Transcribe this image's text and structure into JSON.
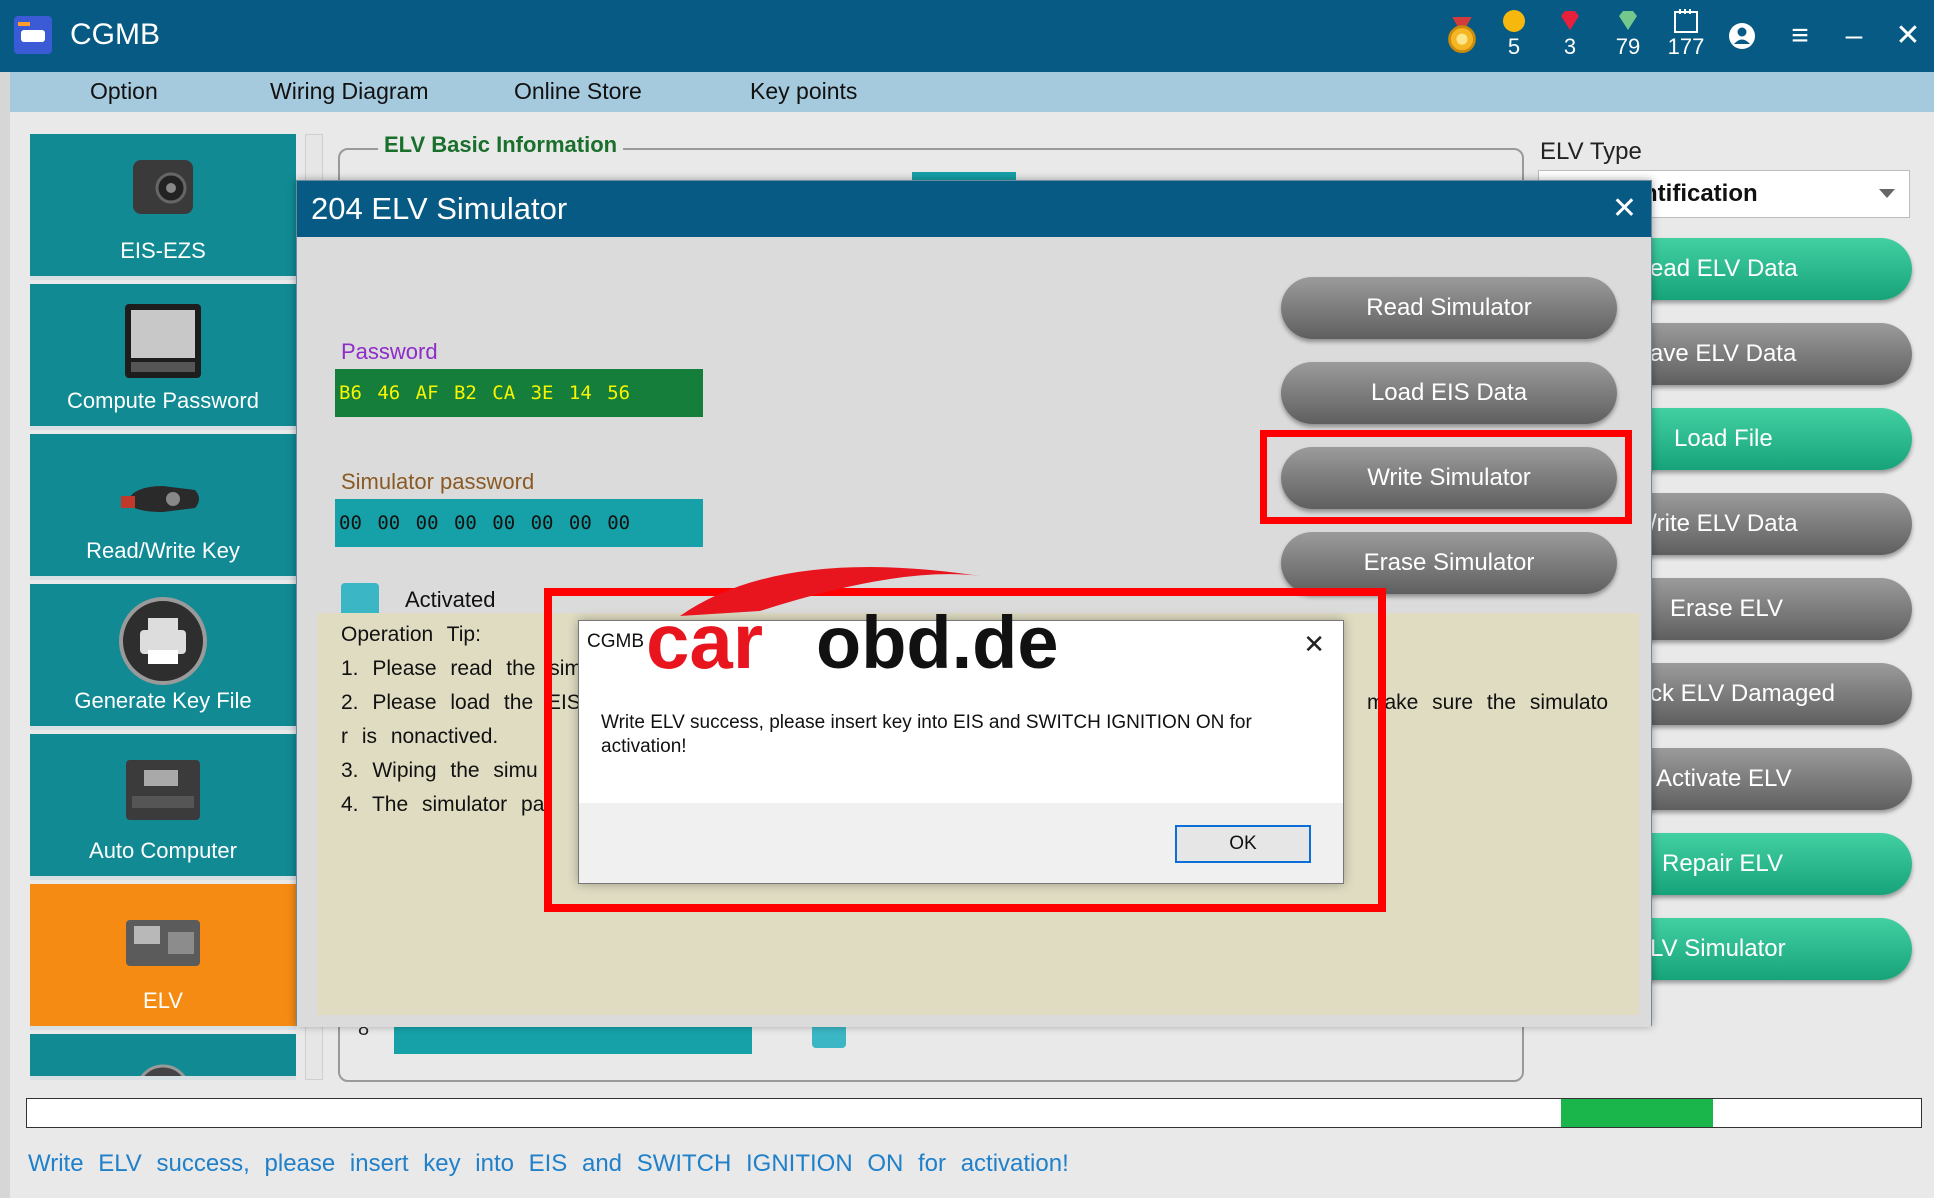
{
  "app": {
    "title": "CGMB",
    "stats": [
      {
        "icon": "medal-icon",
        "value": ""
      },
      {
        "icon": "gold-coin-icon",
        "value": "5"
      },
      {
        "icon": "red-gem-icon",
        "value": "3"
      },
      {
        "icon": "green-gem-icon",
        "value": "79"
      },
      {
        "icon": "calendar-icon",
        "value": "177"
      }
    ]
  },
  "menu": [
    "Option",
    "Wiring Diagram",
    "Online Store",
    "Key points"
  ],
  "sidebar": [
    {
      "label": "EIS-EZS",
      "icon": "eis-module-icon",
      "active": false
    },
    {
      "label": "Compute Password",
      "icon": "chip-icon",
      "active": false
    },
    {
      "label": "Read/Write Key",
      "icon": "car-key-icon",
      "active": false
    },
    {
      "label": "Generate Key File",
      "icon": "printer-icon",
      "active": false
    },
    {
      "label": "Auto Computer",
      "icon": "ecu-icon",
      "active": false
    },
    {
      "label": "ELV",
      "icon": "elv-module-icon",
      "active": true
    }
  ],
  "elv_group": {
    "title": "ELV Basic Information",
    "row_number": "8"
  },
  "elv_type": {
    "label": "ELV Type",
    "selected": "ntification"
  },
  "right_buttons": [
    {
      "label": "ead ELV Data",
      "style": "green"
    },
    {
      "label": "ave ELV Data",
      "style": "gray"
    },
    {
      "label": "Load File",
      "style": "green"
    },
    {
      "label": "/rite ELV Data",
      "style": "gray"
    },
    {
      "label": "Erase ELV",
      "style": "gray"
    },
    {
      "label": "ck ELV Damaged",
      "style": "gray"
    },
    {
      "label": "Activate ELV",
      "style": "gray"
    },
    {
      "label": "Repair ELV",
      "style": "green"
    },
    {
      "label": "LV Simulator",
      "style": "green"
    }
  ],
  "simulator": {
    "title": "204 ELV Simulator",
    "password_label": "Password",
    "password_value": "B6 46 AF B2 CA 3E 14 56",
    "sim_password_label": "Simulator password",
    "sim_password_value": "00 00 00 00 00 00 00 00",
    "activated_label": "Activated",
    "buttons": [
      "Read Simulator",
      "Load EIS Data",
      "Write Simulator",
      "Erase Simulator"
    ],
    "tips": [
      "Operation  Tip:",
      "1.  Please  read  the  sim",
      "2.  Please  load  the  EIS",
      "r  is  nonactived.",
      "3.  Wiping  the  simu",
      "4.  The  simulator  pa"
    ],
    "tip_right": "make  sure  the  simulato"
  },
  "message": {
    "title": "CGMB",
    "text": "Write ELV success, please insert key into EIS and SWITCH IGNITION ON for activation!",
    "ok_label": "OK"
  },
  "watermark": {
    "text_red": "car",
    "text_black": "obd.de"
  },
  "progress": {
    "fraction": 0.08
  },
  "status": "Write ELV success, please insert key into EIS and SWITCH IGNITION ON for activation!",
  "colors": {
    "titlebar": "#075a83",
    "teal": "#118a94",
    "active": "#f58b13",
    "highlight": "#ff0000"
  }
}
